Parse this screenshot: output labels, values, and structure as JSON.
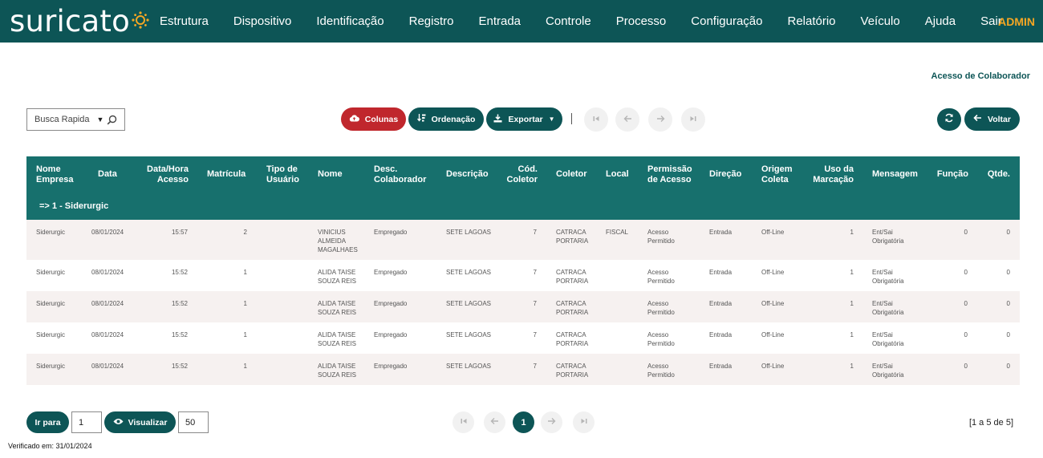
{
  "app": {
    "logo_text": "suricato",
    "menu": [
      "Estrutura",
      "Dispositivo",
      "Identificação",
      "Registro",
      "Entrada",
      "Controle",
      "Processo",
      "Configuração",
      "Relatório",
      "Veículo",
      "Ajuda",
      "Sair"
    ],
    "user": "ADMIN"
  },
  "page": {
    "title": "Acesso de Colaborador"
  },
  "toolbar": {
    "search_value": "Busca Rapida",
    "colunas": "Colunas",
    "ordenacao": "Ordenação",
    "exportar": "Exportar",
    "voltar": "Voltar"
  },
  "table": {
    "headers": [
      "Nome Empresa",
      "Data",
      "Data/Hora Acesso",
      "Matrícula",
      "Tipo de Usuário",
      "Nome",
      "Desc. Colaborador",
      "Descrição",
      "Cód. Coletor",
      "Coletor",
      "Local",
      "Permissão de Acesso",
      "Direção",
      "Origem Coleta",
      "Uso da Marcação",
      "Mensagem",
      "Função",
      "Qtde."
    ],
    "group": "=> 1 - Siderurgic",
    "rows": [
      [
        "Siderurgic",
        "08/01/2024",
        "15:57",
        "2",
        "",
        "VINICIUS ALMEIDA MAGALHAES",
        "Empregado",
        "SETE LAGOAS",
        "7",
        "CATRACA PORTARIA",
        "FISCAL",
        "Acesso Permitido",
        "Entrada",
        "Off-Line",
        "1",
        "Ent/Sai Obrigatória",
        "0",
        "0"
      ],
      [
        "Siderurgic",
        "08/01/2024",
        "15:52",
        "1",
        "",
        "ALIDA TAISE SOUZA REIS",
        "Empregado",
        "SETE LAGOAS",
        "7",
        "CATRACA PORTARIA",
        "",
        "Acesso Permitido",
        "Entrada",
        "Off-Line",
        "1",
        "Ent/Sai Obrigatória",
        "0",
        "0"
      ],
      [
        "Siderurgic",
        "08/01/2024",
        "15:52",
        "1",
        "",
        "ALIDA TAISE SOUZA REIS",
        "Empregado",
        "SETE LAGOAS",
        "7",
        "CATRACA PORTARIA",
        "",
        "Acesso Permitido",
        "Entrada",
        "Off-Line",
        "1",
        "Ent/Sai Obrigatória",
        "0",
        "0"
      ],
      [
        "Siderurgic",
        "08/01/2024",
        "15:52",
        "1",
        "",
        "ALIDA TAISE SOUZA REIS",
        "Empregado",
        "SETE LAGOAS",
        "7",
        "CATRACA PORTARIA",
        "",
        "Acesso Permitido",
        "Entrada",
        "Off-Line",
        "1",
        "Ent/Sai Obrigatória",
        "0",
        "0"
      ],
      [
        "Siderurgic",
        "08/01/2024",
        "15:52",
        "1",
        "",
        "ALIDA TAISE SOUZA REIS",
        "Empregado",
        "SETE LAGOAS",
        "7",
        "CATRACA PORTARIA",
        "",
        "Acesso Permitido",
        "Entrada",
        "Off-Line",
        "1",
        "Ent/Sai Obrigatória",
        "0",
        "0"
      ]
    ]
  },
  "footer": {
    "ir_para": "Ir para",
    "page_input": "1",
    "visualizar": "Visualizar",
    "page_size": "50",
    "current_page": "1",
    "range": "[1 a 5 de 5]",
    "verified": "Verificado em: 31/01/2024"
  },
  "colors": {
    "nav": "#0d5556",
    "header": "#17706d",
    "accent_red": "#c0272d",
    "admin": "#f5a623"
  }
}
